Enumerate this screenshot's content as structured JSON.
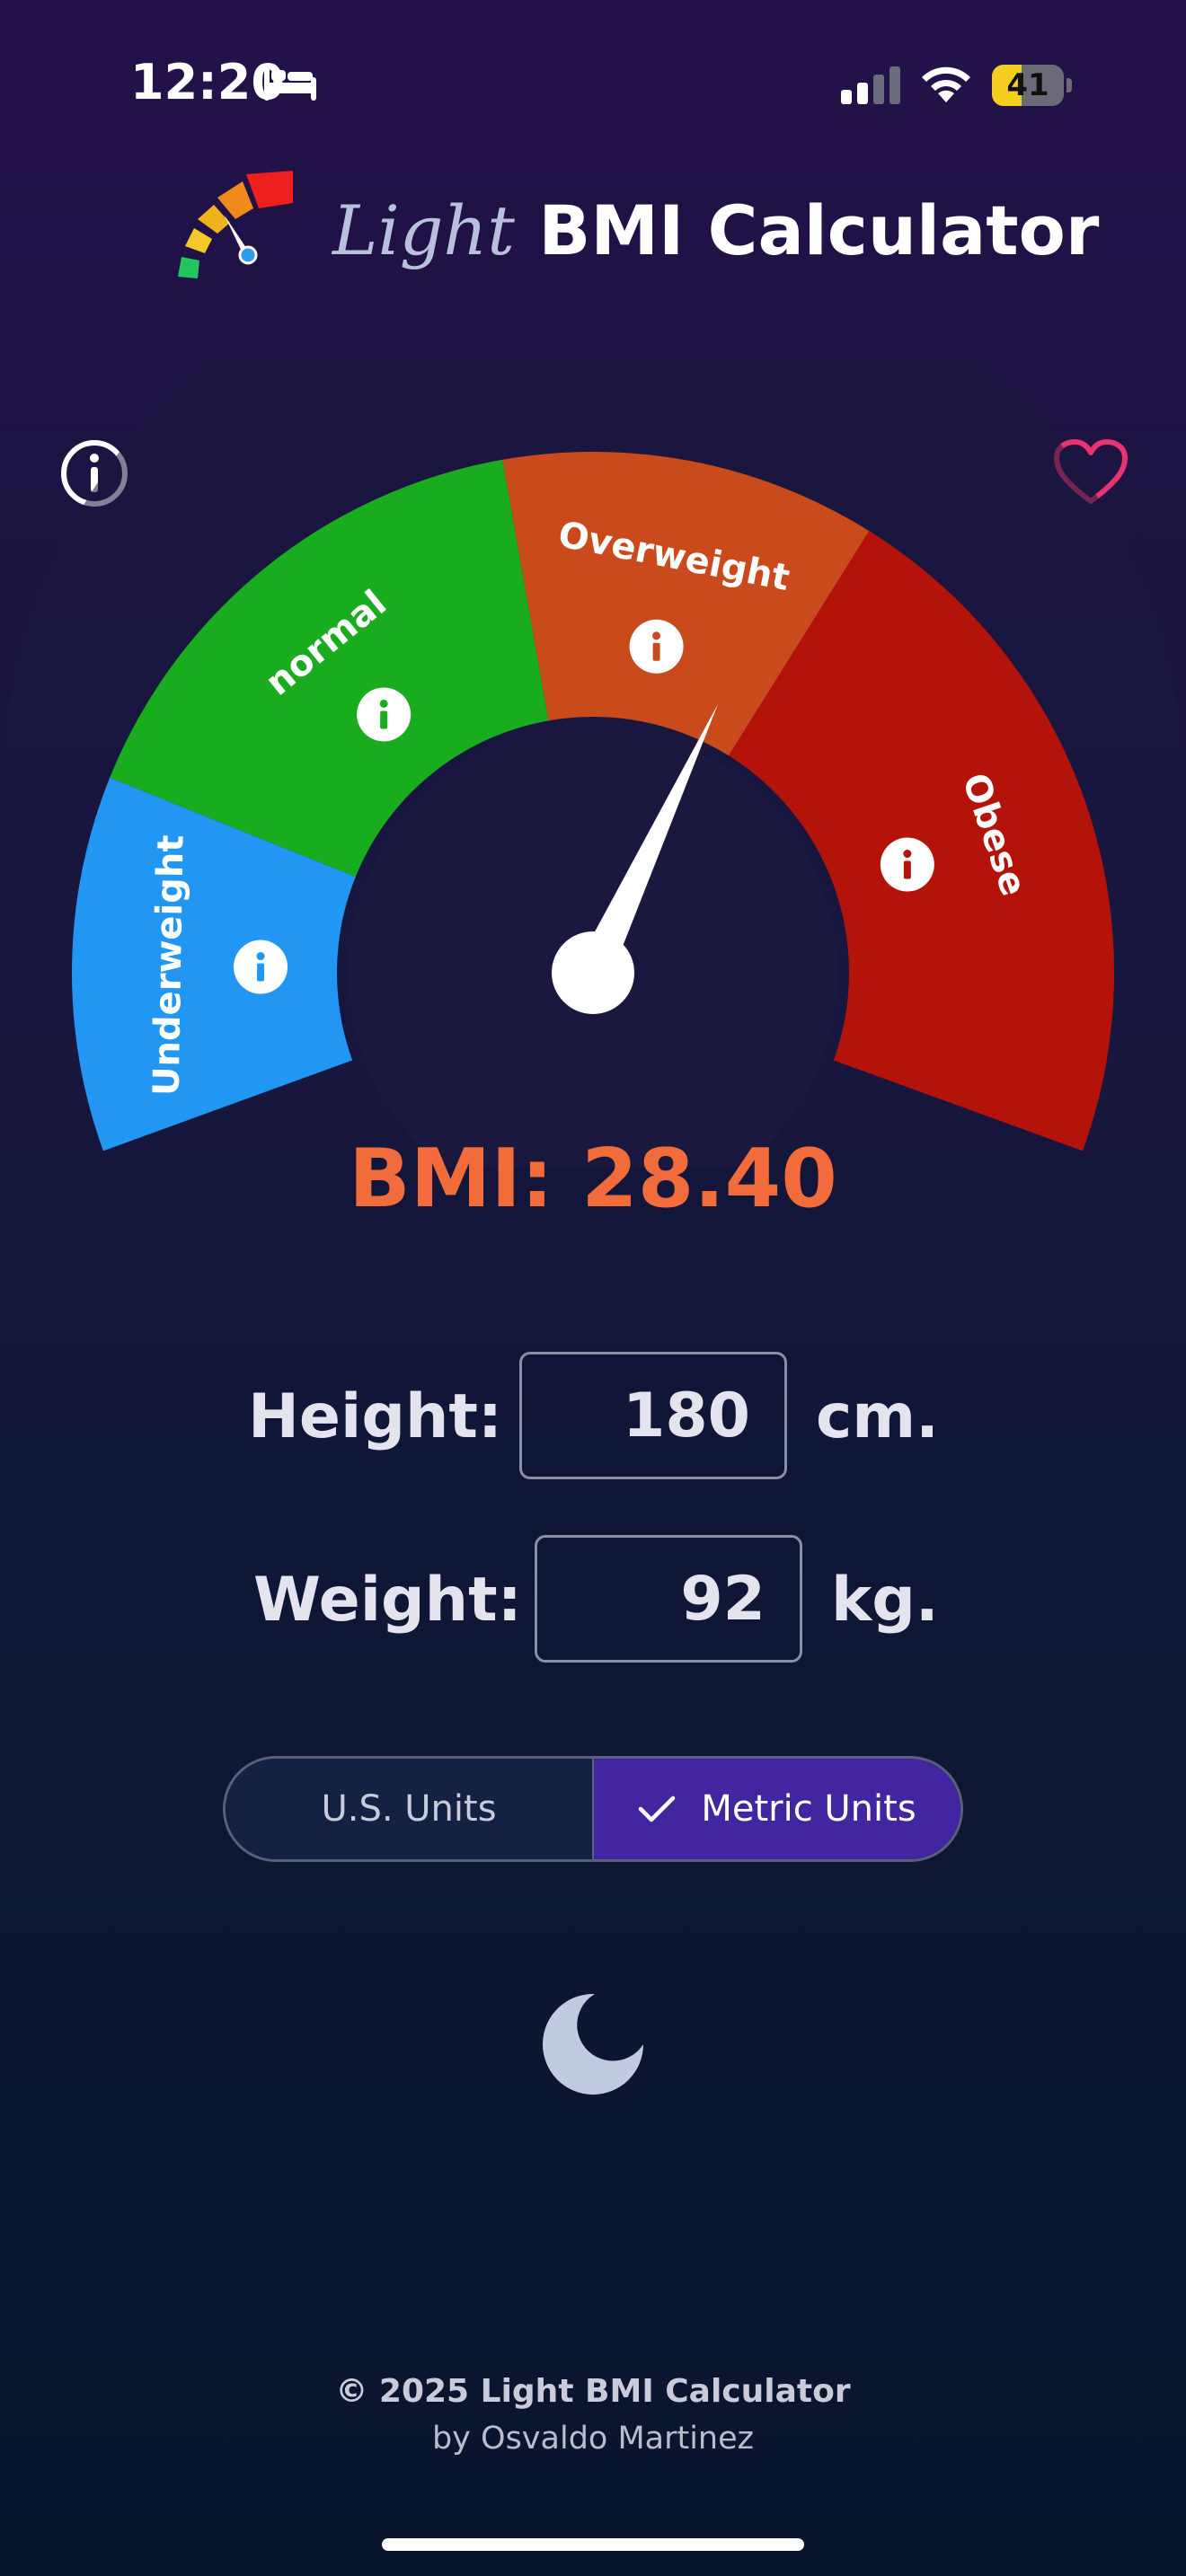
{
  "status_bar": {
    "time": "12:20",
    "battery": "41",
    "battery_level": 0.41
  },
  "app": {
    "title_light": "Light",
    "title_rest": "BMI Calculator"
  },
  "gauge": {
    "segments": [
      {
        "label": "Underweight",
        "color": "#2196f3"
      },
      {
        "label": "normal",
        "color": "#1aac1f"
      },
      {
        "label": "Overweight",
        "color": "#c94a1b"
      },
      {
        "label": "Obese",
        "color": "#b4130a"
      }
    ],
    "bmi": 28.4,
    "hub_color": "#1b1840"
  },
  "result": {
    "bmi_text": "BMI: 28.40",
    "color": "#f26b3a"
  },
  "form": {
    "height_label": "Height:",
    "height_value": "180",
    "height_unit": "cm.",
    "weight_label": "Weight:",
    "weight_value": "92",
    "weight_unit": "kg."
  },
  "units": {
    "us_label": "U.S. Units",
    "metric_label": "Metric Units",
    "selected": "Metric Units"
  },
  "icons": {
    "info": "info-icon",
    "favorite": "heart-icon",
    "theme": "moon-icon"
  },
  "footer": {
    "copyright": "© 2025 Light BMI Calculator",
    "author": "by Osvaldo Martinez"
  }
}
